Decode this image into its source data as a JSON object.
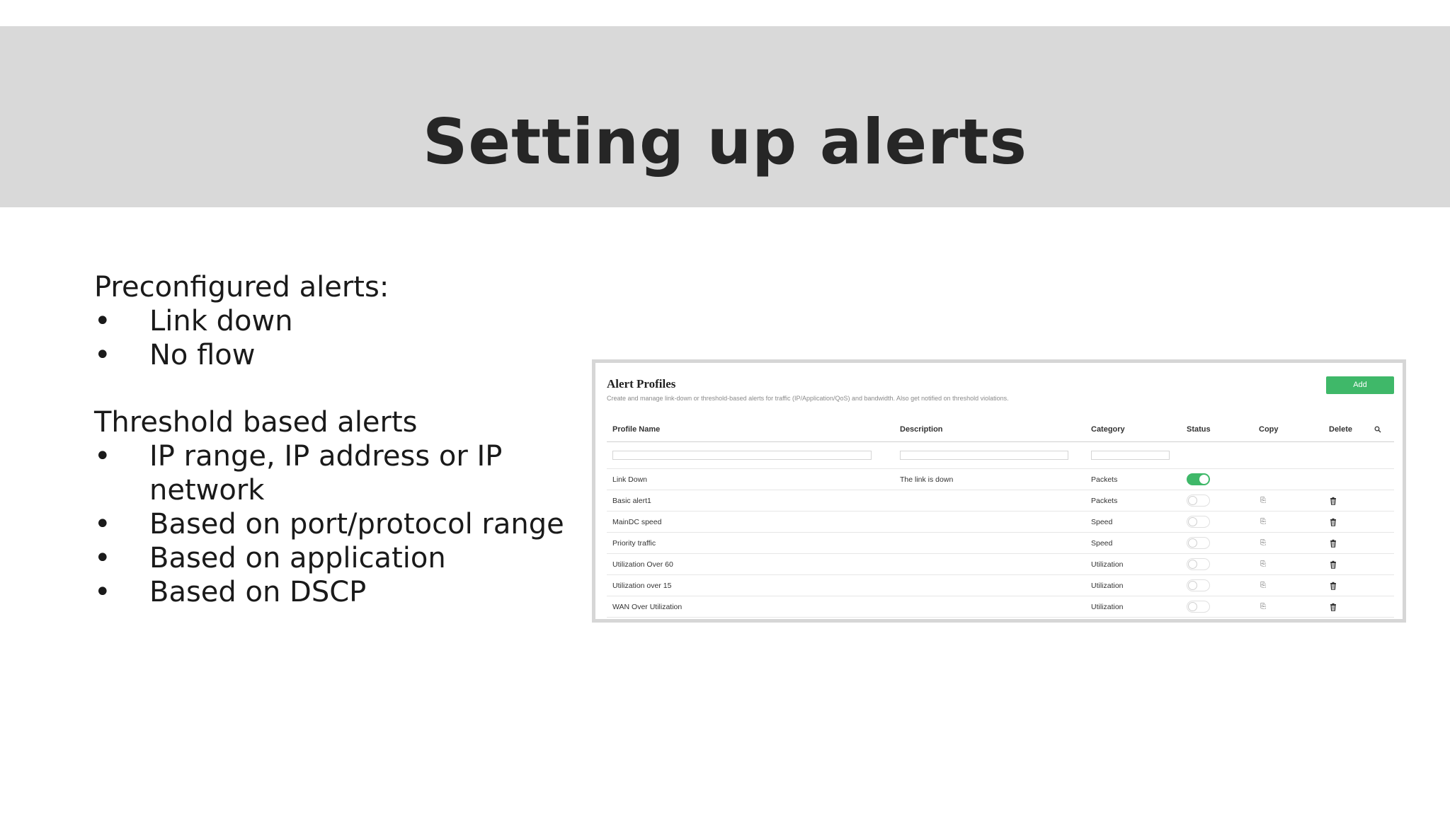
{
  "slide": {
    "title": "Setting up alerts"
  },
  "notes": {
    "sections": [
      {
        "heading": "Preconfigured alerts:",
        "items": [
          "Link down",
          "No flow"
        ]
      },
      {
        "heading": "Threshold based alerts",
        "items": [
          "IP range, IP address or IP network",
          "Based on port/protocol range",
          "Based on application",
          "Based on DSCP"
        ]
      }
    ],
    "bullet": "•"
  },
  "panel": {
    "title": "Alert Profiles",
    "subtitle": "Create and manage link-down or threshold-based alerts for traffic (IP/Application/QoS) and bandwidth. Also get notified on threshold violations.",
    "add_label": "Add",
    "accent_color": "#3fb869",
    "columns": {
      "name": "Profile Name",
      "description": "Description",
      "category": "Category",
      "status": "Status",
      "copy": "Copy",
      "delete": "Delete"
    },
    "rows": [
      {
        "name": "Link Down",
        "description": "The link is down",
        "category": "Packets",
        "enabled": true,
        "copyable": false,
        "deletable": false
      },
      {
        "name": "Basic alert1",
        "description": "",
        "category": "Packets",
        "enabled": false,
        "copyable": true,
        "deletable": true
      },
      {
        "name": "MainDC speed",
        "description": "",
        "category": "Speed",
        "enabled": false,
        "copyable": true,
        "deletable": true
      },
      {
        "name": "Priority traffic",
        "description": "",
        "category": "Speed",
        "enabled": false,
        "copyable": true,
        "deletable": true
      },
      {
        "name": "Utilization Over 60",
        "description": "",
        "category": "Utilization",
        "enabled": false,
        "copyable": true,
        "deletable": true
      },
      {
        "name": "Utilization over 15",
        "description": "",
        "category": "Utilization",
        "enabled": false,
        "copyable": true,
        "deletable": true
      },
      {
        "name": "WAN Over Utilization",
        "description": "",
        "category": "Utilization",
        "enabled": false,
        "copyable": true,
        "deletable": true
      }
    ],
    "icons": {
      "copy": "copy-icon",
      "delete": "trash-icon",
      "search": "search-icon"
    }
  }
}
